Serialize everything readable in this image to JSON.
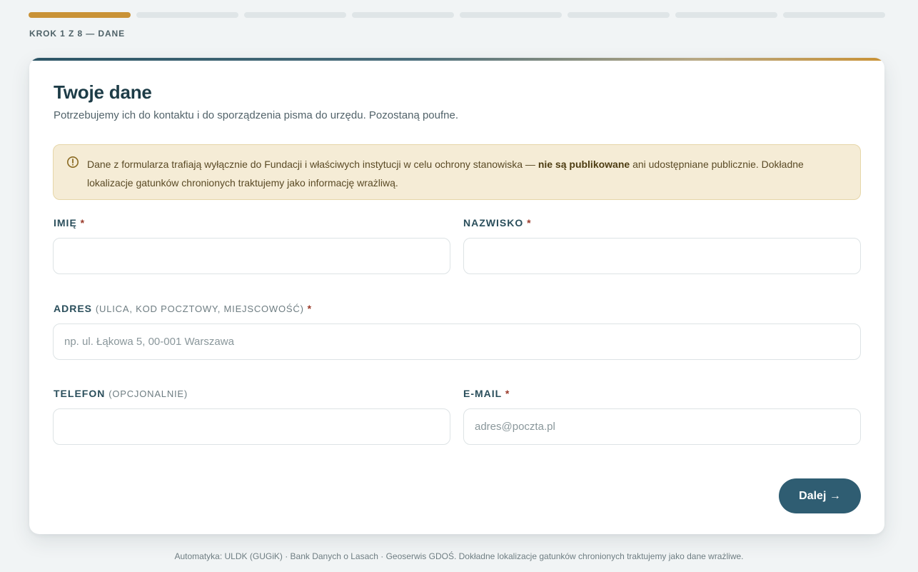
{
  "progress": {
    "total_steps": 8,
    "current_step": 1,
    "label": "KROK 1 Z 8 — DANE"
  },
  "card": {
    "title": "Twoje dane",
    "subtitle": "Potrzebujemy ich do kontaktu i do sporządzenia pisma do urzędu. Pozostaną poufne."
  },
  "notice": {
    "icon": "info-circle-icon",
    "text_before": "Dane z formularza trafiają wyłącznie do Fundacji i właściwych instytucji w celu ochrony stanowiska — ",
    "text_bold": "nie są publikowane",
    "text_after": " ani udostępniane publicznie. Dokładne lokalizacje gatunków chronionych traktujemy jako informację wrażliwą."
  },
  "fields": {
    "first_name": {
      "label": "IMIĘ",
      "required": "*",
      "value": "",
      "placeholder": ""
    },
    "last_name": {
      "label": "NAZWISKO",
      "required": "*",
      "value": "",
      "placeholder": ""
    },
    "address": {
      "label": "ADRES",
      "hint": "(ULICA, KOD POCZTOWY, MIEJSCOWOŚĆ)",
      "required": "*",
      "value": "",
      "placeholder": "np. ul. Łąkowa 5, 00-001 Warszawa"
    },
    "phone": {
      "label": "TELEFON",
      "hint": "(OPCJONALNIE)",
      "value": "",
      "placeholder": ""
    },
    "email": {
      "label": "E-MAIL",
      "required": "*",
      "value": "",
      "placeholder": "adres@poczta.pl"
    }
  },
  "actions": {
    "next_label": "Dalej →"
  },
  "footer": {
    "text": "Automatyka: ULDK (GUGiK) · Bank Danych o Lasach · Geoserwis GDOŚ. Dokładne lokalizacje gatunków chronionych traktujemy jako dane wrażliwe."
  },
  "colors": {
    "accent": "#c99236",
    "primary": "#2f5d72",
    "notice_bg": "#f5ecd6",
    "background": "#f1f4f5"
  }
}
